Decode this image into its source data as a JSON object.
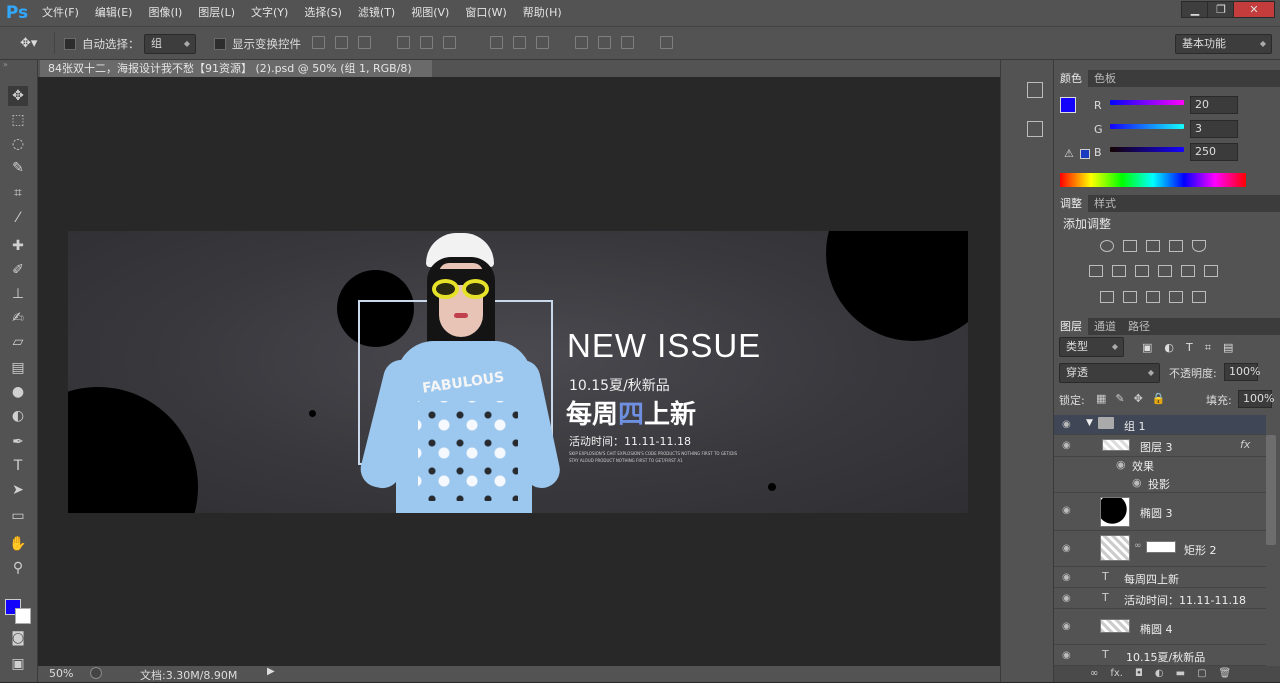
{
  "app": {
    "logo": "Ps"
  },
  "menu": [
    "文件(F)",
    "编辑(E)",
    "图像(I)",
    "图层(L)",
    "文字(Y)",
    "选择(S)",
    "滤镜(T)",
    "视图(V)",
    "窗口(W)",
    "帮助(H)"
  ],
  "window_controls": {
    "minimize": "▁",
    "restore": "❐",
    "close": "✕"
  },
  "options": {
    "auto_select_label": "自动选择：",
    "auto_select_value": "组",
    "show_transform_label": "显示变换控件",
    "workspace": "基本功能"
  },
  "document": {
    "tab_title": "84张双十二，海报设计我不愁【91资源】 (2).psd @ 50% (组 1, RGB/8) *",
    "tab_close": "×"
  },
  "canvas": {
    "headline": "NEW ISSUE",
    "date_line": "10.15夏/秋新品",
    "main_a": "每周",
    "main_b": "四",
    "main_c": "上新",
    "activity": "活动时间：11.11-11.18",
    "tiny1": "SKIP EXPLOSION'S CHIT EXPLOSION'S CODE PRODUCTS NOTHING FIRST TO GET/DIS",
    "tiny2": "STAY ALOUD PRODUCT NOTHING FIRST TO GET/FIRST A1",
    "shirt_text": "FABULOUS"
  },
  "status": {
    "zoom": "50%",
    "doc": "文档:3.30M/8.90M"
  },
  "color_panel": {
    "tabs": [
      "颜色",
      "色板"
    ],
    "channels": [
      {
        "label": "R",
        "value": "20"
      },
      {
        "label": "G",
        "value": "3"
      },
      {
        "label": "B",
        "value": "250"
      }
    ],
    "foreground": "#1403fa"
  },
  "adjust_panel": {
    "tabs": [
      "调整",
      "样式"
    ],
    "title": "添加调整"
  },
  "layers_panel": {
    "tabs": [
      "图层",
      "通道",
      "路径"
    ],
    "filter": "类型",
    "blend": "穿透",
    "opacity_label": "不透明度:",
    "opacity": "100%",
    "lock_label": "锁定:",
    "fill_label": "填充:",
    "fill": "100%",
    "layers": [
      {
        "name": "组 1",
        "kind": "group"
      },
      {
        "name": "图层 3",
        "kind": "pixel",
        "fx": "fx"
      },
      {
        "name": "效果",
        "kind": "effect"
      },
      {
        "name": "投影",
        "kind": "effect2"
      },
      {
        "name": "椭圆 3",
        "kind": "shape"
      },
      {
        "name": "矩形 2",
        "kind": "shape"
      },
      {
        "name": "每周四上新",
        "kind": "text"
      },
      {
        "name": "活动时间：11.11-11.18",
        "kind": "text"
      },
      {
        "name": "椭圆 4",
        "kind": "shape"
      },
      {
        "name": "10.15夏/秋新品",
        "kind": "text"
      }
    ]
  }
}
